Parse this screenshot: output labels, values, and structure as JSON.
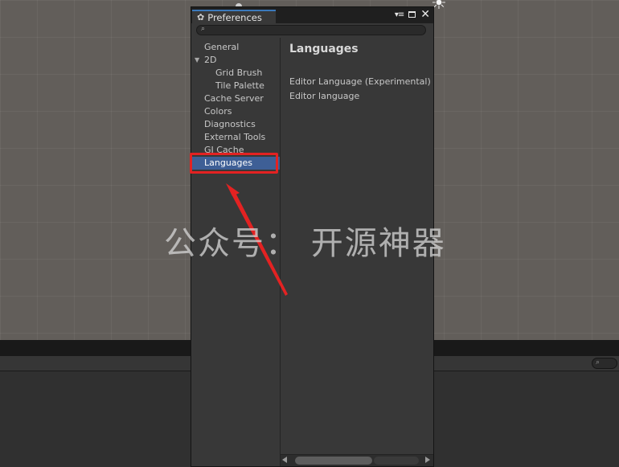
{
  "window": {
    "tab_title": "Preferences",
    "icons": {
      "tab": "gear-icon",
      "menu": "menu-icon",
      "maximize": "maximize-icon",
      "close": "close-icon",
      "search": "search-icon"
    },
    "close_symbol": "✕",
    "menu_symbol": "▾≡",
    "search": {
      "value": "",
      "placeholder": ""
    }
  },
  "sidebar": {
    "items": [
      {
        "label": "General"
      },
      {
        "label": "2D"
      },
      {
        "label": "Grid Brush"
      },
      {
        "label": "Tile Palette"
      },
      {
        "label": "Cache Server"
      },
      {
        "label": "Colors"
      },
      {
        "label": "Diagnostics"
      },
      {
        "label": "External Tools"
      },
      {
        "label": "GI Cache"
      },
      {
        "label": "Languages"
      }
    ],
    "selected": "Languages"
  },
  "content": {
    "title": "Languages",
    "settings": [
      {
        "label": "Editor Language (Experimental)"
      },
      {
        "label": "Editor language"
      }
    ]
  },
  "watermark": "公众号： 开源神器",
  "colors": {
    "selection": "#3e5f96",
    "highlight_box": "#e32222",
    "arrow": "#e32222",
    "tab_accent": "#3a79bb"
  }
}
